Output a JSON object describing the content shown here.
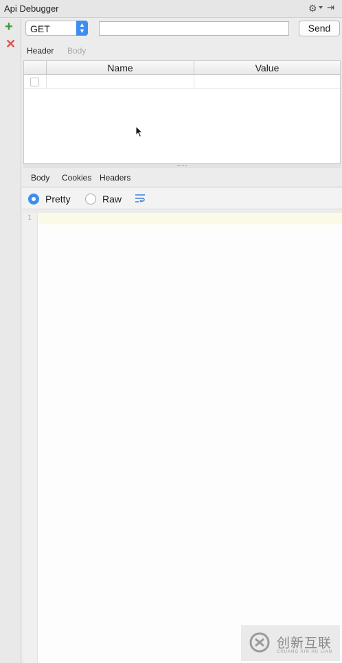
{
  "window": {
    "title": "Api Debugger",
    "settings_icon": "gear-icon",
    "hide_icon": "hide-panel-icon"
  },
  "toolbar": {
    "add_icon": "plus-icon",
    "remove_icon": "close-icon"
  },
  "request": {
    "method": "GET",
    "url_value": "",
    "send_label": "Send",
    "tabs": [
      {
        "label": "Header",
        "active": true
      },
      {
        "label": "Body",
        "active": false
      }
    ],
    "table": {
      "columns": [
        "Name",
        "Value"
      ],
      "rows": [
        {
          "enabled": false,
          "name": "",
          "value": ""
        }
      ]
    }
  },
  "response": {
    "tabs": [
      {
        "label": "Body",
        "active": true
      },
      {
        "label": "Cookies",
        "active": false
      },
      {
        "label": "Headers",
        "active": false
      }
    ],
    "view_options": [
      {
        "label": "Pretty",
        "selected": true
      },
      {
        "label": "Raw",
        "selected": false
      }
    ],
    "wrap_icon": "soft-wrap-icon",
    "editor": {
      "line_numbers": [
        "1"
      ],
      "content": ""
    }
  },
  "watermark": {
    "text_cn": "创新互联",
    "text_en": "CHUANG XIN HU LIAN"
  },
  "colors": {
    "accent": "#3d8ef0",
    "add": "#3a9a3a",
    "remove": "#d9524f"
  }
}
